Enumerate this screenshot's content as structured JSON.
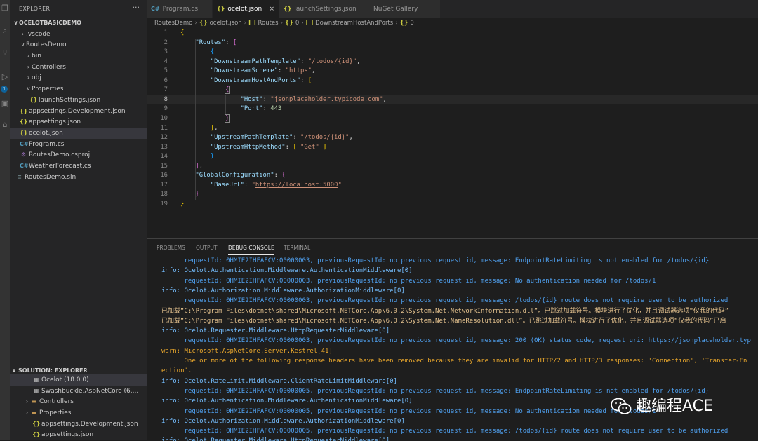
{
  "explorer": {
    "title": "EXPLORER",
    "more": "···",
    "items": [
      {
        "label": "OCELOTBASICDEMO",
        "indent": 4,
        "chev": "∨",
        "icon": "",
        "kind": "",
        "bold": true
      },
      {
        "label": ".vscode",
        "indent": 14,
        "chev": "›",
        "icon": "",
        "kind": ""
      },
      {
        "label": "RoutesDemo",
        "indent": 14,
        "chev": "∨",
        "icon": "",
        "kind": ""
      },
      {
        "label": "bin",
        "indent": 22,
        "chev": "›",
        "icon": "",
        "kind": ""
      },
      {
        "label": "Controllers",
        "indent": 22,
        "chev": "›",
        "icon": "",
        "kind": ""
      },
      {
        "label": "obj",
        "indent": 22,
        "chev": "›",
        "icon": "",
        "kind": ""
      },
      {
        "label": "Properties",
        "indent": 22,
        "chev": "∨",
        "icon": "",
        "kind": ""
      },
      {
        "label": "launchSettings.json",
        "indent": 28,
        "chev": "",
        "icon": "{}",
        "kind": "json"
      },
      {
        "label": "appsettings.Development.json",
        "indent": 14,
        "chev": "",
        "icon": "{}",
        "kind": "json"
      },
      {
        "label": "appsettings.json",
        "indent": 14,
        "chev": "",
        "icon": "{}",
        "kind": "json"
      },
      {
        "label": "ocelot.json",
        "indent": 14,
        "chev": "",
        "icon": "{}",
        "kind": "json",
        "selected": true
      },
      {
        "label": "Program.cs",
        "indent": 14,
        "chev": "",
        "icon": "C#",
        "kind": "cs"
      },
      {
        "label": "RoutesDemo.csproj",
        "indent": 14,
        "chev": "",
        "icon": "⚙",
        "kind": "proj"
      },
      {
        "label": "WeatherForecast.cs",
        "indent": 14,
        "chev": "",
        "icon": "C#",
        "kind": "cs"
      },
      {
        "label": "RoutesDemo.sln",
        "indent": 8,
        "chev": "",
        "icon": "≡",
        "kind": "sln"
      }
    ]
  },
  "solution": {
    "title": "SOLUTION: EXPLORER",
    "items": [
      {
        "label": "Ocelot (18.0.0)",
        "indent": 32,
        "chev": "",
        "icon": "▦",
        "kind": "pkg",
        "selected": true
      },
      {
        "label": "Swashbuckle.AspNetCore (6....",
        "indent": 32,
        "chev": "",
        "icon": "▦",
        "kind": "pkg"
      },
      {
        "label": "Controllers",
        "indent": 20,
        "chev": "›",
        "icon": "▬",
        "kind": "folder"
      },
      {
        "label": "Properties",
        "indent": 20,
        "chev": "›",
        "icon": "▬",
        "kind": "folder"
      },
      {
        "label": "appsettings.Development.json",
        "indent": 32,
        "chev": "",
        "icon": "{}",
        "kind": "json"
      },
      {
        "label": "appsettings.json",
        "indent": 32,
        "chev": "",
        "icon": "{}",
        "kind": "json"
      }
    ]
  },
  "tabs": [
    {
      "label": "Program.cs",
      "icon": "C#",
      "kind": "cs",
      "active": false
    },
    {
      "label": "ocelot.json",
      "icon": "{}",
      "kind": "json",
      "active": true,
      "close": "×"
    },
    {
      "label": "launchSettings.json",
      "icon": "{}",
      "kind": "json",
      "active": false
    },
    {
      "label": "NuGet Gallery",
      "icon": "",
      "kind": "",
      "active": false
    }
  ],
  "breadcrumb": [
    {
      "icon": "",
      "text": "RoutesDemo"
    },
    {
      "icon": "{}",
      "text": "ocelot.json"
    },
    {
      "icon": "[ ]",
      "text": "Routes"
    },
    {
      "icon": "{}",
      "text": "0"
    },
    {
      "icon": "[ ]",
      "text": "DownstreamHostAndPorts"
    },
    {
      "icon": "{}",
      "text": "0"
    }
  ],
  "code_lines": [
    {
      "n": "1",
      "code": "{"
    },
    {
      "n": "2",
      "code": "    \"Routes\": ["
    },
    {
      "n": "3",
      "code": "        {"
    },
    {
      "n": "4",
      "code": "        \"DownstreamPathTemplate\": \"/todos/{id}\","
    },
    {
      "n": "5",
      "code": "        \"DownstreamScheme\": \"https\","
    },
    {
      "n": "6",
      "code": "        \"DownstreamHostAndPorts\": ["
    },
    {
      "n": "7",
      "code": "            {"
    },
    {
      "n": "8",
      "code": "                \"Host\": \"jsonplaceholder.typicode.com\","
    },
    {
      "n": "9",
      "code": "                \"Port\": 443"
    },
    {
      "n": "10",
      "code": "            }"
    },
    {
      "n": "11",
      "code": "        ],"
    },
    {
      "n": "12",
      "code": "        \"UpstreamPathTemplate\": \"/todos/{id}\","
    },
    {
      "n": "13",
      "code": "        \"UpstreamHttpMethod\": [ \"Get\" ]"
    },
    {
      "n": "14",
      "code": "        }"
    },
    {
      "n": "15",
      "code": "    ],"
    },
    {
      "n": "16",
      "code": "    \"GlobalConfiguration\": {"
    },
    {
      "n": "17",
      "code": "        \"BaseUrl\": \"https://localhost:5000\""
    },
    {
      "n": "18",
      "code": "    }"
    },
    {
      "n": "19",
      "code": "}"
    }
  ],
  "panel": {
    "tabs": [
      "PROBLEMS",
      "OUTPUT",
      "DEBUG CONSOLE",
      "TERMINAL"
    ],
    "active_tab": "DEBUG CONSOLE",
    "lines": [
      {
        "kind": "detail",
        "text": "      requestId: 0HMIE2IHFAFCV:00000003, previousRequestId: no previous request id, message: EndpointRateLimiting is not enabled for /todos/{id}"
      },
      {
        "kind": "info",
        "text": "info: Ocelot.Authentication.Middleware.AuthenticationMiddleware[0]"
      },
      {
        "kind": "detail",
        "text": "      requestId: 0HMIE2IHFAFCV:00000003, previousRequestId: no previous request id, message: No authentication needed for /todos/1"
      },
      {
        "kind": "info",
        "text": "info: Ocelot.Authorization.Middleware.AuthorizationMiddleware[0]"
      },
      {
        "kind": "detail",
        "text": "      requestId: 0HMIE2IHFAFCV:00000003, previousRequestId: no previous request id, message: /todos/{id} route does not require user to be authorized"
      },
      {
        "kind": "loaded",
        "text": "已加载“C:\\Program Files\\dotnet\\shared\\Microsoft.NETCore.App\\6.0.2\\System.Net.NetworkInformation.dll”。已跳过加载符号。模块进行了优化，并且调试器选项“仅我的代码”"
      },
      {
        "kind": "loaded",
        "text": "已加载“C:\\Program Files\\dotnet\\shared\\Microsoft.NETCore.App\\6.0.2\\System.Net.NameResolution.dll”。已跳过加载符号。模块进行了优化，并且调试器选项“仅我的代码”已启"
      },
      {
        "kind": "info",
        "text": "info: Ocelot.Requester.Middleware.HttpRequesterMiddleware[0]"
      },
      {
        "kind": "detail",
        "text": "      requestId: 0HMIE2IHFAFCV:00000003, previousRequestId: no previous request id, message: 200 (OK) status code, request uri: https://jsonplaceholder.typ"
      },
      {
        "kind": "warn",
        "text": "warn: Microsoft.AspNetCore.Server.Kestrel[41]"
      },
      {
        "kind": "warn",
        "text": "      One or more of the following response headers have been removed because they are invalid for HTTP/2 and HTTP/3 responses: 'Connection', 'Transfer-En"
      },
      {
        "kind": "warn",
        "text": "ection'."
      },
      {
        "kind": "info",
        "text": "info: Ocelot.RateLimit.Middleware.ClientRateLimitMiddleware[0]"
      },
      {
        "kind": "detail",
        "text": "      requestId: 0HMIE2IHFAFCV:00000005, previousRequestId: no previous request id, message: EndpointRateLimiting is not enabled for /todos/{id}"
      },
      {
        "kind": "info",
        "text": "info: Ocelot.Authentication.Middleware.AuthenticationMiddleware[0]"
      },
      {
        "kind": "detail",
        "text": "      requestId: 0HMIE2IHFAFCV:00000005, previousRequestId: no previous request id, message: No authentication needed for /todos/1"
      },
      {
        "kind": "info",
        "text": "info: Ocelot.Authorization.Middleware.AuthorizationMiddleware[0]"
      },
      {
        "kind": "detail",
        "text": "      requestId: 0HMIE2IHFAFCV:00000005, previousRequestId: no previous request id, message: /todos/{id} route does not require user to be authorized"
      },
      {
        "kind": "info",
        "text": "info: Ocelot.Requester.Middleware.HttpRequesterMiddleware[0]"
      }
    ]
  },
  "watermark": {
    "text": "趣编程ACE",
    "icon": "wechat-icon"
  }
}
